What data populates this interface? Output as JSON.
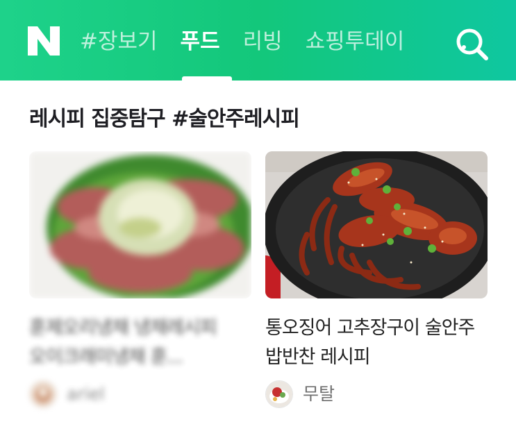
{
  "header": {
    "logo": "N",
    "tabs": [
      {
        "label": "#장보기",
        "active": false
      },
      {
        "label": "푸드",
        "active": true
      },
      {
        "label": "리빙",
        "active": false
      },
      {
        "label": "쇼핑투데이",
        "active": false
      }
    ],
    "search_icon": "search-icon",
    "colors": {
      "gradient_start": "#1ed28a",
      "gradient_end": "#0fc7a0"
    }
  },
  "section": {
    "title": "레시피 집중탐구 #술안주레시피"
  },
  "cards": [
    {
      "title": "훈제오리냉채 냉채레시피 오이크래미냉채 훈...",
      "author": "ariel",
      "blurred": true
    },
    {
      "title": "통오징어 고추장구이 술안주 밥반찬 레시피",
      "author": "무탈",
      "blurred": false
    }
  ]
}
